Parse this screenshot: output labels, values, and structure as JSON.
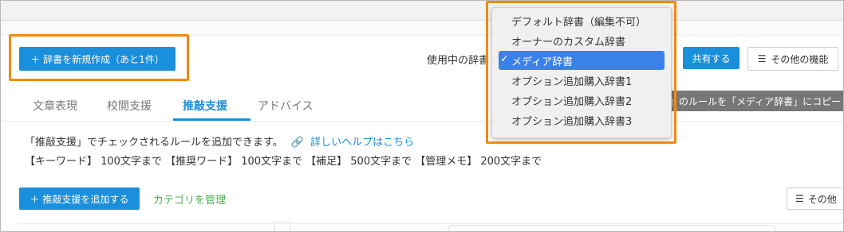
{
  "header": {
    "new_dictionary_button": "＋  辞書を新規作成（あと1件）",
    "dictionary_in_use_label": "使用中の辞書",
    "share_button": "共有する",
    "more_functions_button": "その他の機能",
    "more_functions_icon": "menu-icon"
  },
  "dictionary_dropdown": {
    "options": [
      "デフォルト辞書（編集不可）",
      "オーナーのカスタム辞書",
      "メディア辞書",
      "オプション追加購入辞書1",
      "オプション追加購入辞書2",
      "オプション追加購入辞書3"
    ],
    "selected_index": 2,
    "selected_mark": "✓"
  },
  "tooltip": {
    "text": "』のルールを「メディア辞書」にコピー"
  },
  "tabs": [
    {
      "label": "文章表現",
      "active": false
    },
    {
      "label": "校閲支援",
      "active": false
    },
    {
      "label": "推敲支援",
      "active": true
    },
    {
      "label": "アドバイス",
      "active": false
    }
  ],
  "main": {
    "description": "「推敲支援」でチェックされるルールを追加できます。",
    "help_link": "詳しいヘルプはこちら",
    "help_icon": "link-icon",
    "limits": "【キーワード】 100文字まで 【推奨ワード】 100文字まで 【補足】 500文字まで 【管理メモ】 200文字まで",
    "add_rule_button": "＋  推敲支援を追加する",
    "manage_category_link": "カテゴリを管理",
    "bottom_more_button": "その他"
  },
  "colors": {
    "accent": "#1a8fdc",
    "highlight": "#f08a12",
    "selected_option": "#3a82ea",
    "category_link": "#4caf50"
  }
}
